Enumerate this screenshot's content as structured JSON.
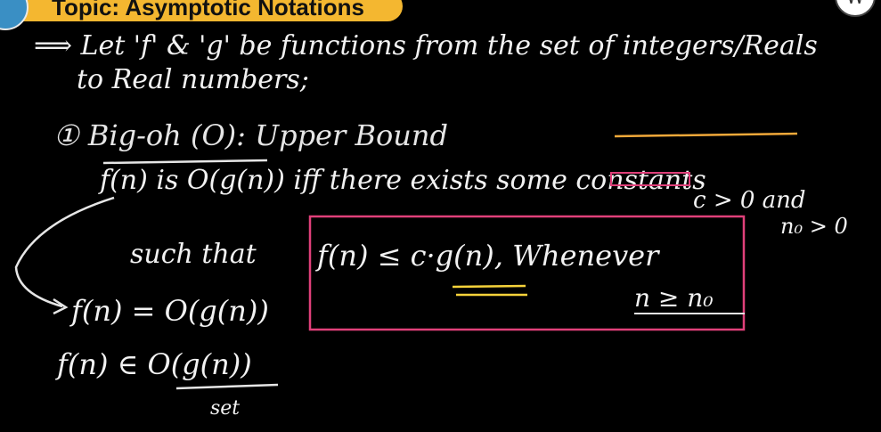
{
  "header": {
    "topic": "Topic: Asymptotic Notations",
    "logo_letter": "W"
  },
  "colors": {
    "background": "#000000",
    "ink": "#f2f2f2",
    "topic_bar": "#f4b730",
    "highlight_box": "#e0407a",
    "underline_orange": "#f2a93a",
    "underline_yellow": "#f5d23a",
    "logo_blue": "#3a8fc4"
  },
  "notes": {
    "line1": "⟹ Let 'f' & 'g' be functions from the set of integers/Reals",
    "line2": "to Real numbers;",
    "heading": "① Big-oh (O): Upper Bound",
    "definition": "f(n) is O(g(n)) iff there exists some constants",
    "constant_c": "c > 0 and",
    "constant_n0": "n₀ > 0",
    "such_that": "such that",
    "inequality": "f(n) ≤ c·g(n), Whenever",
    "condition": "n ≥ n₀",
    "form1": "f(n) = O(g(n))",
    "form2": "f(n) ∈ O(g(n))",
    "set_label": "set"
  }
}
